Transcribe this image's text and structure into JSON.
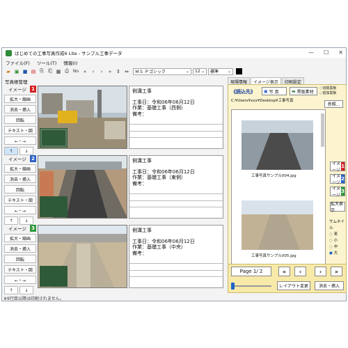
{
  "window": {
    "title": "はじめての工事写真作成6 Lite - サンプル工事データ",
    "controls": {
      "minimize": "—",
      "maximize": "☐",
      "close": "✕"
    }
  },
  "menu": [
    "ファイル(F)",
    "ツール(T)",
    "情報(I)"
  ],
  "toolbar": {
    "font": "ＭＳ Ｐゴシック",
    "size": "12",
    "style": "標準",
    "no_label": "No"
  },
  "left_header": "写真帳管理",
  "slots": [
    {
      "tag": "イメージ",
      "num": "1",
      "badge_color": "#d62020",
      "buttons": [
        "拡大・縮画",
        "消去・挿入",
        "回転",
        "テキスト・図"
      ],
      "arrows": [
        "←・→",
        "↑",
        "↓"
      ],
      "text": [
        "側溝工事",
        "工事日：令和06年06月12日",
        "作業：基礎工事（西側）",
        "備考："
      ]
    },
    {
      "tag": "イメージ",
      "num": "2",
      "badge_color": "#2a60c8",
      "buttons": [
        "拡大・縮画",
        "消去・挿入",
        "回転",
        "テキスト・図"
      ],
      "arrows": [
        "←・→",
        "↑",
        "↓"
      ],
      "text": [
        "側溝工事",
        "工事日：令和06年06月12日",
        "作業：基礎工事（東側）",
        "備考："
      ]
    },
    {
      "tag": "イメージ",
      "num": "3",
      "badge_color": "#2e9a3a",
      "buttons": [
        "拡大・縮画",
        "消去・挿入",
        "回転",
        "テキスト・図"
      ],
      "arrows": [
        "←・→",
        "↑",
        "↓"
      ],
      "text": [
        "側溝工事",
        "工事日：令和06年06月12日",
        "作業：基礎工事（中央）",
        "備考："
      ]
    }
  ],
  "right": {
    "tabs": [
      "現場情報",
      "イメージ表示",
      "印刷設定"
    ],
    "source_label": "《読込先》",
    "photo_btn": "写 真",
    "board_btn": "黒板素材",
    "radio_opts": [
      "切絵黒板",
      "追加黒板"
    ],
    "path": "C:¥Users¥xxx¥Desktop¥工事写真",
    "ref_btn": "参照...",
    "thumbs": [
      "工事写真サンプル004.jpg",
      "工事写真サンプル005.jpg"
    ],
    "image_btns": [
      {
        "label": "イメージ",
        "num": "1",
        "color": "#d62020"
      },
      {
        "label": "イメージ",
        "num": "2",
        "color": "#2a60c8"
      },
      {
        "label": "イメージ",
        "num": "3",
        "color": "#2e9a3a"
      }
    ],
    "zoom_btn": "拡大表示",
    "thumb_size_label": "サムネイル",
    "thumb_sizes": [
      "来",
      "小",
      "中",
      "大"
    ],
    "page_text": "Page 1/ 2",
    "layout_btn": "レイアウト変更",
    "erase_btn": "消去・挿入"
  },
  "status": "※9行目以降は印刷されません。"
}
